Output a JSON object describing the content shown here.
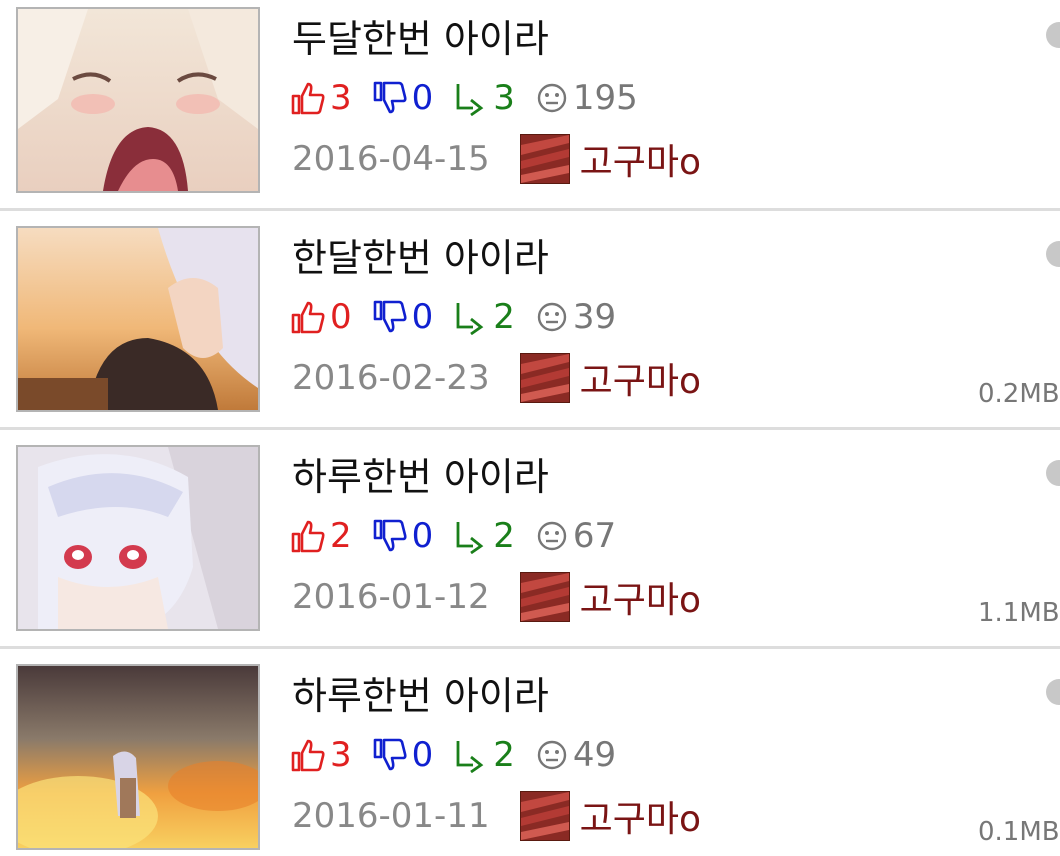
{
  "posts": [
    {
      "title": "두달한번 아이라",
      "up": "3",
      "down": "0",
      "replies": "3",
      "views": "195",
      "date": "2016-04-15",
      "author": "고구마o",
      "size": "",
      "thumb": "anime-crying-girl"
    },
    {
      "title": "한달한번 아이라",
      "up": "0",
      "down": "0",
      "replies": "2",
      "views": "39",
      "date": "2016-02-23",
      "author": "고구마o",
      "size": "0.2MB",
      "thumb": "anime-sunset-couple"
    },
    {
      "title": "하루한번 아이라",
      "up": "2",
      "down": "0",
      "replies": "2",
      "views": "67",
      "date": "2016-01-12",
      "author": "고구마o",
      "size": "1.1MB",
      "thumb": "anime-silver-hair-girl"
    },
    {
      "title": "하루한번 아이라",
      "up": "3",
      "down": "0",
      "replies": "2",
      "views": "49",
      "date": "2016-01-11",
      "author": "고구마o",
      "size": "0.1MB",
      "thumb": "anime-sunset-field"
    }
  ],
  "icons": {
    "up": "thumbs-up-icon",
    "down": "thumbs-down-icon",
    "reply": "reply-arrow-icon",
    "views": "eye-face-icon",
    "unread": "unread-dot-icon"
  },
  "colors": {
    "up": "#e02020",
    "down": "#1020d0",
    "reply": "#1a7f1a",
    "author": "#7a1414",
    "date": "#888888"
  }
}
